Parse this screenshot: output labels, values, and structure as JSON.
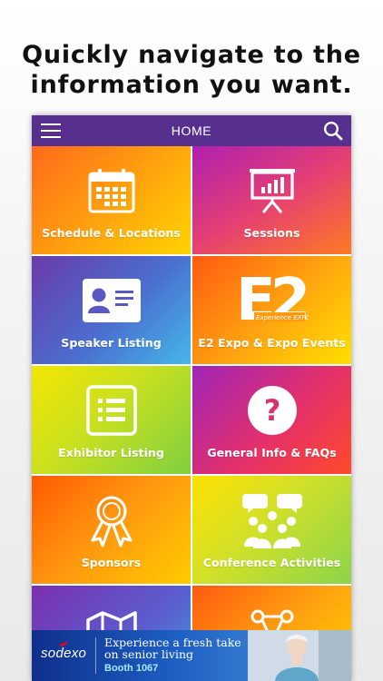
{
  "headline": {
    "line1": "Quickly navigate to the",
    "line2": "information you want."
  },
  "navbar": {
    "title": "HOME",
    "menu_icon": "hamburger-menu-icon",
    "search_icon": "search-icon",
    "color": "#57308f"
  },
  "tiles": [
    {
      "label": "Schedule & Locations",
      "icon": "calendar-icon"
    },
    {
      "label": "Sessions",
      "icon": "presentation-board-icon"
    },
    {
      "label": "Speaker Listing",
      "icon": "id-card-icon"
    },
    {
      "label": "E2 Expo & Expo Events",
      "icon": "e2-expo-logo",
      "logo_text": "E2",
      "logo_subtext": "Experience EXPO"
    },
    {
      "label": "Exhibitor Listing",
      "icon": "list-icon"
    },
    {
      "label": "General Info & FAQs",
      "icon": "question-icon"
    },
    {
      "label": "Sponsors",
      "icon": "award-ribbon-icon"
    },
    {
      "label": "Conference Activities",
      "icon": "people-chat-icon"
    },
    {
      "label": "",
      "icon": "map-icon"
    },
    {
      "label": "",
      "icon": "network-icon"
    }
  ],
  "ad": {
    "brand": "sodexo",
    "headline": "Experience a fresh take on senior living",
    "booth": "Booth 1067"
  }
}
